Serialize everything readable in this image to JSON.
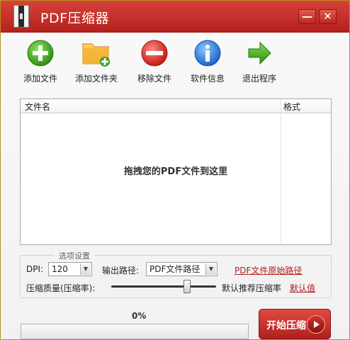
{
  "window": {
    "title": "PDF压缩器",
    "minimize_label": "—",
    "close_label": "✕",
    "colors": {
      "titlebar": "#c12d26",
      "accent_link": "#b0201b",
      "start_button": "#c7302a"
    }
  },
  "toolbar": {
    "items": [
      {
        "label": "添加文件",
        "icon": "add-file-icon"
      },
      {
        "label": "添加文件夹",
        "icon": "add-folder-icon"
      },
      {
        "label": "移除文件",
        "icon": "remove-file-icon"
      },
      {
        "label": "软件信息",
        "icon": "info-icon"
      },
      {
        "label": "退出程序",
        "icon": "exit-arrow-icon"
      }
    ]
  },
  "filelist": {
    "columns": [
      "文件名",
      "格式"
    ],
    "rows": [],
    "drop_hint": "拖拽您的PDF文件到这里"
  },
  "options": {
    "legend": "选项设置",
    "dpi_label": "DPI:",
    "dpi_value": "120",
    "output_label": "输出路径:",
    "output_value": "PDF文件路径",
    "output_link": "PDF文件原始路径",
    "quality_label": "压缩质量(压缩率):",
    "quality_level": 0.72,
    "quality_hint": "默认推荐压缩率",
    "default_link": "默认值"
  },
  "progress": {
    "percent_text": "0%",
    "value": 0
  },
  "start_button": {
    "label": "开始压缩"
  }
}
